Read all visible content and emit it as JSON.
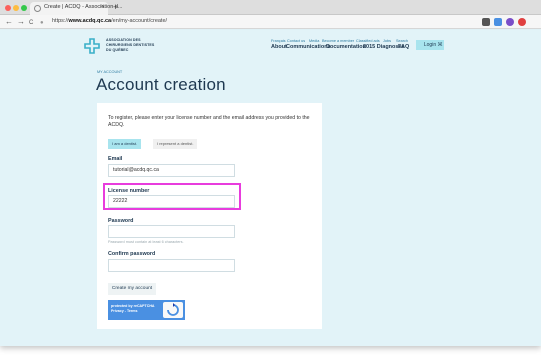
{
  "browser": {
    "tab_title": "Create | ACDQ - Association d...",
    "tab_close": "×",
    "new_tab": "+",
    "url_prefix": "https://",
    "url_host": "www.acdq.qc.ca",
    "url_path": "/en/my-account/create/",
    "nav": {
      "back": "←",
      "forward": "→",
      "reload": "C"
    },
    "colors": {
      "close": "#fc605c",
      "minimize": "#fdbc40",
      "maximize": "#34c84a"
    }
  },
  "site": {
    "logo_lines": [
      "ASSOCIATION DES",
      "CHIRURGIENS DENTISTES",
      "DU QUÉBEC"
    ],
    "nav_small": [
      "Français",
      "Contact us",
      "Media",
      "Become a member",
      "Classified ads",
      "Jobs",
      "Search"
    ],
    "nav_main": [
      "About",
      "Communications",
      "Documentation",
      "2015 Diagnoses",
      "FAQ"
    ],
    "login_label": "Login",
    "lang_label": "Ж"
  },
  "breadcrumb": "MY ACCOUNT",
  "page_title": "Account creation",
  "form": {
    "intro": "To register, please enter your license number and the email address you provided to the ACDQ.",
    "role_dentist": "I am a dentist.",
    "role_represent": "I represent a dentist.",
    "email_label": "Email",
    "email_value": "tutorial@acdq.qc.ca",
    "license_label": "License number",
    "license_value": "22222",
    "password_label": "Password",
    "password_hint": "Password must contain at least 6 characters.",
    "confirm_label": "Confirm password",
    "submit_label": "Create my account",
    "captcha_line1": "protected by reCAPTCHA",
    "captcha_line2": "Privacy - Terms"
  },
  "colors": {
    "brand": "#1e3850",
    "accent": "#a8e4ee",
    "highlight": "#e83cdd"
  }
}
